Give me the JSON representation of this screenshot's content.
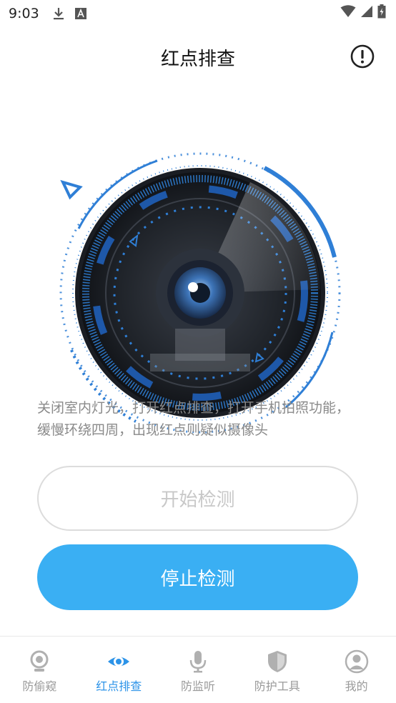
{
  "status_bar": {
    "time": "9:03",
    "icons": [
      "download-icon",
      "a-notification-icon",
      "wifi-icon",
      "signal-icon",
      "battery-icon"
    ]
  },
  "header": {
    "title": "红点排查",
    "info_icon": "info-icon"
  },
  "scanner": {
    "accent_color": "#2f7fd6",
    "icon": "camera-lens-icon"
  },
  "hint": {
    "text": "关闭室内灯光，打开红点排查，打开手机拍照功能，缓慢环绕四周，出现红点则疑似摄像头"
  },
  "buttons": {
    "start_label": "开始检测",
    "stop_label": "停止检测"
  },
  "tabbar": {
    "active_color": "#2c93e8",
    "inactive_color": "#9a9a9a",
    "items": [
      {
        "label": "防偷窥",
        "icon": "webcam-icon"
      },
      {
        "label": "红点排查",
        "icon": "eye-icon"
      },
      {
        "label": "防监听",
        "icon": "microphone-icon"
      },
      {
        "label": "防护工具",
        "icon": "shield-icon"
      },
      {
        "label": "我的",
        "icon": "user-icon"
      }
    ]
  }
}
